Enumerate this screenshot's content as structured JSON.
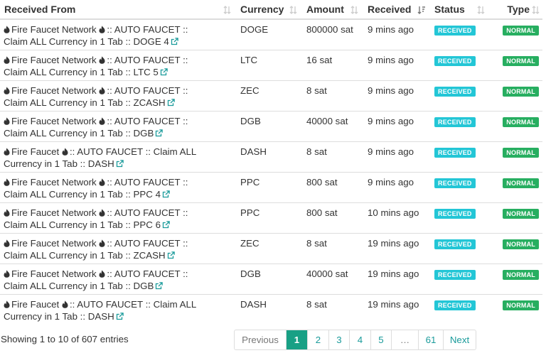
{
  "columns": {
    "received_from": "Received From",
    "currency": "Currency",
    "amount": "Amount",
    "received": "Received",
    "status": "Status",
    "type": "Type"
  },
  "rows": [
    {
      "line1": "Fire Faucet Network",
      "line1b": ":: AUTO FAUCET ::",
      "line2": "Claim ALL Currency in 1 Tab :: DOGE 4",
      "currency": "DOGE",
      "amount": "800000 sat",
      "received": "9 mins ago",
      "status": "RECEIVED",
      "type": "NORMAL"
    },
    {
      "line1": "Fire Faucet Network",
      "line1b": ":: AUTO FAUCET ::",
      "line2": "Claim ALL Currency in 1 Tab :: LTC 5",
      "currency": "LTC",
      "amount": "16 sat",
      "received": "9 mins ago",
      "status": "RECEIVED",
      "type": "NORMAL"
    },
    {
      "line1": "Fire Faucet Network",
      "line1b": ":: AUTO FAUCET ::",
      "line2": "Claim ALL Currency in 1 Tab :: ZCASH",
      "currency": "ZEC",
      "amount": "8 sat",
      "received": "9 mins ago",
      "status": "RECEIVED",
      "type": "NORMAL"
    },
    {
      "line1": "Fire Faucet Network",
      "line1b": ":: AUTO FAUCET ::",
      "line2": "Claim ALL Currency in 1 Tab :: DGB",
      "currency": "DGB",
      "amount": "40000 sat",
      "received": "9 mins ago",
      "status": "RECEIVED",
      "type": "NORMAL"
    },
    {
      "line1": "Fire Faucet",
      "line1b": ":: AUTO FAUCET :: Claim ALL",
      "line2": "Currency in 1 Tab :: DASH",
      "currency": "DASH",
      "amount": "8 sat",
      "received": "9 mins ago",
      "status": "RECEIVED",
      "type": "NORMAL"
    },
    {
      "line1": "Fire Faucet Network",
      "line1b": ":: AUTO FAUCET ::",
      "line2": "Claim ALL Currency in 1 Tab :: PPC 4",
      "currency": "PPC",
      "amount": "800 sat",
      "received": "9 mins ago",
      "status": "RECEIVED",
      "type": "NORMAL"
    },
    {
      "line1": "Fire Faucet Network",
      "line1b": ":: AUTO FAUCET ::",
      "line2": "Claim ALL Currency in 1 Tab :: PPC 6",
      "currency": "PPC",
      "amount": "800 sat",
      "received": "10 mins ago",
      "status": "RECEIVED",
      "type": "NORMAL"
    },
    {
      "line1": "Fire Faucet Network",
      "line1b": ":: AUTO FAUCET ::",
      "line2": "Claim ALL Currency in 1 Tab :: ZCASH",
      "currency": "ZEC",
      "amount": "8 sat",
      "received": "19 mins ago",
      "status": "RECEIVED",
      "type": "NORMAL"
    },
    {
      "line1": "Fire Faucet Network",
      "line1b": ":: AUTO FAUCET ::",
      "line2": "Claim ALL Currency in 1 Tab :: DGB",
      "currency": "DGB",
      "amount": "40000 sat",
      "received": "19 mins ago",
      "status": "RECEIVED",
      "type": "NORMAL"
    },
    {
      "line1": "Fire Faucet",
      "line1b": ":: AUTO FAUCET :: Claim ALL",
      "line2": "Currency in 1 Tab :: DASH",
      "currency": "DASH",
      "amount": "8 sat",
      "received": "19 mins ago",
      "status": "RECEIVED",
      "type": "NORMAL"
    }
  ],
  "info": "Showing 1 to 10 of 607 entries",
  "pagination": {
    "previous": "Previous",
    "pages": [
      "1",
      "2",
      "3",
      "4",
      "5",
      "…",
      "61"
    ],
    "next": "Next",
    "active": "1"
  },
  "colors": {
    "status_badge": "#23c6d6",
    "type_badge": "#27ae60",
    "active_page": "#18a085",
    "link": "#1a9b9b"
  },
  "icons": {
    "source_prefix": "fire-icon",
    "source_link": "external-link-icon",
    "sort": "sort-icon"
  }
}
